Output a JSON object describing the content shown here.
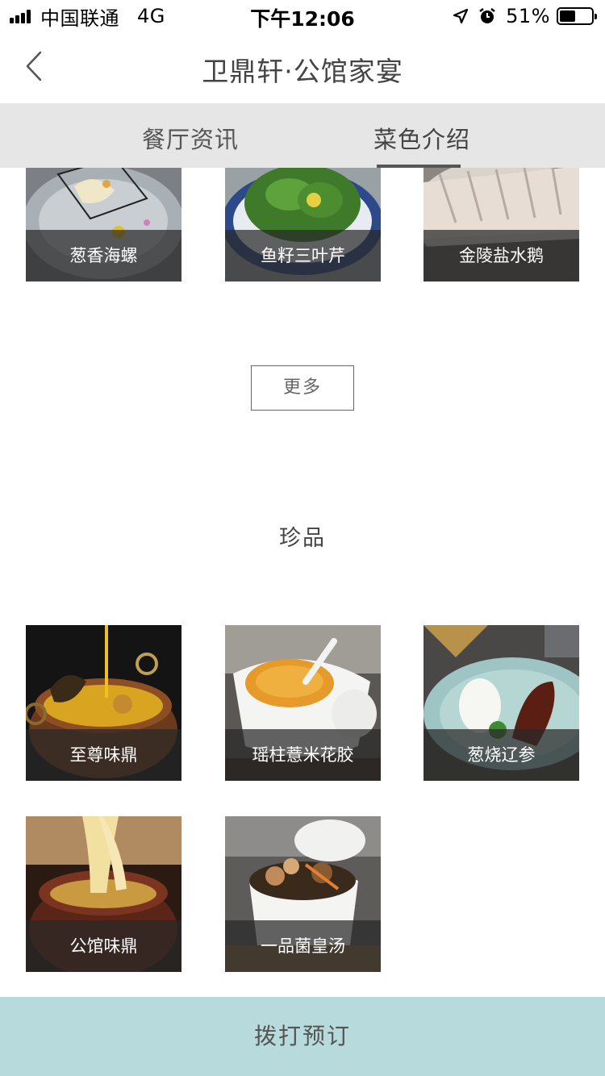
{
  "status_bar": {
    "carrier": "中国联通",
    "network": "4G",
    "time": "下午12:06",
    "battery_percent": "51%",
    "battery_level": 0.51
  },
  "header": {
    "title": "卫鼎轩·公馆家宴"
  },
  "tabs": [
    {
      "label": "餐厅资讯",
      "active": false
    },
    {
      "label": "菜色介绍",
      "active": true
    }
  ],
  "top_dishes": [
    {
      "name": "葱香海螺"
    },
    {
      "name": "鱼籽三叶芹"
    },
    {
      "name": "金陵盐水鹅"
    }
  ],
  "more_label": "更多",
  "section": {
    "title": "珍品",
    "dishes": [
      {
        "name": "至尊味鼎"
      },
      {
        "name": "瑶柱薏米花胶"
      },
      {
        "name": "葱烧辽参"
      },
      {
        "name": "公馆味鼎"
      },
      {
        "name": "一品菌皇汤"
      }
    ]
  },
  "call_button": "拨打预订",
  "colors": {
    "tab_bar_bg": "#e6e6e6",
    "call_bar_bg": "#b7dbdc",
    "caption_bg": "#282828"
  }
}
